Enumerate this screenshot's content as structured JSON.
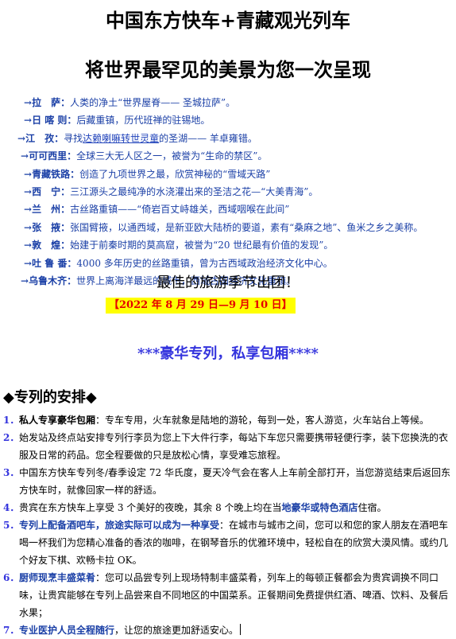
{
  "title_main": "中国东方快车+青藏观光列车",
  "title_sub": "将世界最罕见的美景为您一次呈现",
  "arrow": "→",
  "destinations": [
    {
      "name": "拉　萨：",
      "desc": "人类的净土“世界屋脊—— 圣城拉萨”。"
    },
    {
      "name": "日 喀 则：",
      "desc": "后藏重镇，历代班禅的驻锡地。"
    },
    {
      "name": "江　孜：",
      "desc_before": "寻找",
      "link": "达赖喇嘛转世灵童",
      "desc": "的圣湖—— 羊卓雍错。"
    },
    {
      "name": "可可西里：",
      "desc": "全球三大无人区之一，被誉为“生命的禁区”。"
    },
    {
      "name": "青藏铁路：",
      "desc": "创造了九项世界之最，欣赏神秘的“雪域天路”"
    },
    {
      "name": "西　宁：",
      "desc": "三江源头之最纯净的水浇灌出来的圣洁之花—“大美青海”。"
    },
    {
      "name": "兰　州：",
      "desc": "古丝路重镇——“倚岩百丈峙雄关，西域咽喉在此间”"
    },
    {
      "name": "张　掖：",
      "desc": "张国臂掖，以通西域，是新亚欧大陆桥的要道，素有“桑麻之地”、鱼米之乡之美称。"
    },
    {
      "name": "敦　煌：",
      "desc": "始建于前秦时期的莫高窟，被誉为“20 世纪最有价值的发现”。"
    },
    {
      "name": "吐 鲁 番：",
      "desc": "4000 多年历史的丝路重镇，曾为古西域政治经济文化中心。"
    },
    {
      "name": "乌鲁木齐：",
      "desc": "世界上离海洋最远的城市，西域古国经济文化重镇。"
    }
  ],
  "season_text": "最佳的旅游季节出团！",
  "dates_text": "【2022 年 8 月 29 日—9 月 10 日】",
  "luxury_text": "***豪华专列，私享包厢****",
  "arrangements_heading": "◆专列的安排◆",
  "items": [
    {
      "num": "1．",
      "highlight": "私人专享豪华包厢",
      "text": "：专车专用，火车就象是陆地的游轮，每到一处，客人游览，火车站台上等候。"
    },
    {
      "num": "2．",
      "text": "始发站及终点站安排专列行李员为您上下大件行李，每站下车您只需要携带轻便行李，装下您换洗的衣服及日常的药品。您全程要做的只是放松心情，享受难忘旅程。"
    },
    {
      "num": "3．",
      "text": "中国东方快车专列冬/春季设定 72 华氏度，夏天冷气会在客人上车前全部打开，当您游览结束后返回东方快车时，就像回家一样的舒适。"
    },
    {
      "num": "4．",
      "text_before": "贵宾在东方快车上享受 3 个美好的夜晚，其余 8 个晚上均在当",
      "blue": "地豪华或特色酒店",
      "text": "住宿。"
    },
    {
      "num": "5．",
      "highlight": "专列上配备酒吧车，旅途实际可以成为一种享受",
      "text": "：在城市与城市之间，您可以和您的家人朋友在酒吧车喝一杯我们为您精心准备的香浓的咖啡，在钢琴音乐的优雅环境中，轻松自在的欣赏大漠风情。或约几个好友下棋、欢畅卡拉 OK。"
    },
    {
      "num": "6．",
      "highlight": "厨师现烹丰盛菜肴",
      "text": "：您可以品尝专列上现场特制丰盛菜肴，列车上的每顿正餐都会为贵宾调换不同口味，让贵宾能够在专列上品尝来自不同地区的中国菜系。正餐期间免费提供红酒、啤酒、饮料、及餐后水果；"
    },
    {
      "num": "7．",
      "highlight": "专业医护人员全程随行",
      "text": "，让您的旅途更加舒适安心。"
    }
  ],
  "colors": {
    "blue_text": "#1a3fa6",
    "number_blue": "#3333dd",
    "date_red": "#e60000",
    "highlight_yellow": "#ffff00"
  }
}
